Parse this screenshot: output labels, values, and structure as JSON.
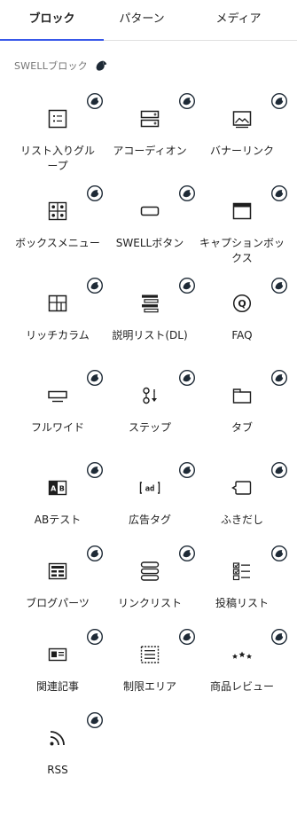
{
  "tabs": [
    {
      "label": "ブロック"
    },
    {
      "label": "パターン"
    },
    {
      "label": "メディア"
    }
  ],
  "category": {
    "title": "SWELLブロック"
  },
  "blocks": [
    {
      "label": "リスト入りグループ",
      "icon": "list-box-icon"
    },
    {
      "label": "アコーディオン",
      "icon": "accordion-icon"
    },
    {
      "label": "バナーリンク",
      "icon": "banner-image-icon"
    },
    {
      "label": "ボックスメニュー",
      "icon": "box-menu-icon"
    },
    {
      "label": "SWELLボタン",
      "icon": "button-icon"
    },
    {
      "label": "キャプションボックス",
      "icon": "caption-box-icon"
    },
    {
      "label": "リッチカラム",
      "icon": "rich-column-icon"
    },
    {
      "label": "説明リスト(DL)",
      "icon": "description-list-icon"
    },
    {
      "label": "FAQ",
      "icon": "faq-icon"
    },
    {
      "label": "フルワイド",
      "icon": "full-wide-icon"
    },
    {
      "label": "ステップ",
      "icon": "step-icon"
    },
    {
      "label": "タブ",
      "icon": "tab-icon"
    },
    {
      "label": "ABテスト",
      "icon": "ab-test-icon"
    },
    {
      "label": "広告タグ",
      "icon": "ad-tag-icon"
    },
    {
      "label": "ふきだし",
      "icon": "balloon-icon"
    },
    {
      "label": "ブログパーツ",
      "icon": "blog-parts-icon"
    },
    {
      "label": "リンクリスト",
      "icon": "link-list-icon"
    },
    {
      "label": "投稿リスト",
      "icon": "post-list-icon"
    },
    {
      "label": "関連記事",
      "icon": "related-post-icon"
    },
    {
      "label": "制限エリア",
      "icon": "restricted-area-icon"
    },
    {
      "label": "商品レビュー",
      "icon": "product-review-icon"
    },
    {
      "label": "RSS",
      "icon": "rss-icon"
    }
  ],
  "colors": {
    "accent": "#3858e9",
    "badge": "#1e2a36",
    "text": "#1e1e1e",
    "muted": "#757575"
  }
}
